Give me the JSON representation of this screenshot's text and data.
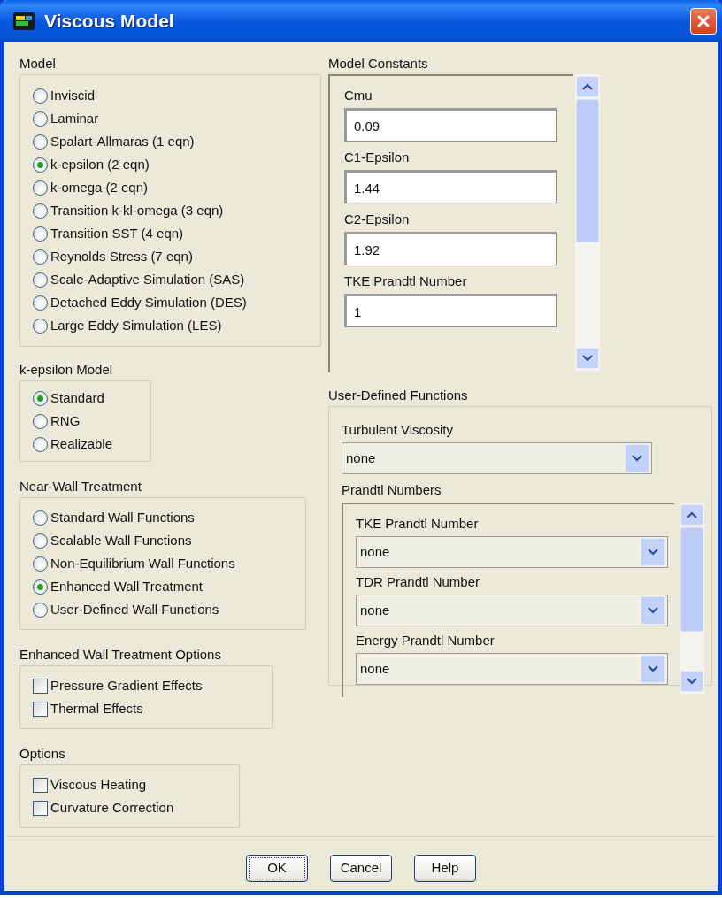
{
  "window": {
    "title": "Viscous Model"
  },
  "model": {
    "label": "Model",
    "options": [
      {
        "label": "Inviscid",
        "selected": false
      },
      {
        "label": "Laminar",
        "selected": false
      },
      {
        "label": "Spalart-Allmaras (1 eqn)",
        "selected": false
      },
      {
        "label": "k-epsilon (2 eqn)",
        "selected": true
      },
      {
        "label": "k-omega (2 eqn)",
        "selected": false
      },
      {
        "label": "Transition k-kl-omega (3 eqn)",
        "selected": false
      },
      {
        "label": "Transition SST (4 eqn)",
        "selected": false
      },
      {
        "label": "Reynolds Stress (7 eqn)",
        "selected": false
      },
      {
        "label": "Scale-Adaptive Simulation (SAS)",
        "selected": false
      },
      {
        "label": "Detached Eddy Simulation (DES)",
        "selected": false
      },
      {
        "label": "Large Eddy Simulation (LES)",
        "selected": false
      }
    ]
  },
  "k_epsilon_model": {
    "label": "k-epsilon Model",
    "options": [
      {
        "label": "Standard",
        "selected": true
      },
      {
        "label": "RNG",
        "selected": false
      },
      {
        "label": "Realizable",
        "selected": false
      }
    ]
  },
  "near_wall_treatment": {
    "label": "Near-Wall Treatment",
    "options": [
      {
        "label": "Standard Wall Functions",
        "selected": false
      },
      {
        "label": "Scalable Wall Functions",
        "selected": false
      },
      {
        "label": "Non-Equilibrium Wall Functions",
        "selected": false
      },
      {
        "label": "Enhanced Wall Treatment",
        "selected": true
      },
      {
        "label": "User-Defined Wall Functions",
        "selected": false
      }
    ]
  },
  "enhanced_wall_treatment_options": {
    "label": "Enhanced Wall Treatment Options",
    "options": [
      {
        "label": "Pressure Gradient Effects",
        "checked": false
      },
      {
        "label": "Thermal Effects",
        "checked": false
      }
    ]
  },
  "options": {
    "label": "Options",
    "options": [
      {
        "label": "Viscous Heating",
        "checked": false
      },
      {
        "label": "Curvature Correction",
        "checked": false
      }
    ]
  },
  "model_constants": {
    "label": "Model Constants",
    "fields": [
      {
        "label": "Cmu",
        "value": "0.09"
      },
      {
        "label": "C1-Epsilon",
        "value": "1.44"
      },
      {
        "label": "C2-Epsilon",
        "value": "1.92"
      },
      {
        "label": "TKE Prandtl Number",
        "value": "1"
      }
    ]
  },
  "user_defined_functions": {
    "label": "User-Defined Functions",
    "turbulent_viscosity": {
      "label": "Turbulent Viscosity",
      "value": "none"
    },
    "prandtl_numbers": {
      "label": "Prandtl Numbers",
      "fields": [
        {
          "label": "TKE Prandtl Number",
          "value": "none"
        },
        {
          "label": "TDR Prandtl Number",
          "value": "none"
        },
        {
          "label": "Energy Prandtl Number",
          "value": "none"
        }
      ]
    }
  },
  "buttons": [
    {
      "label": "OK",
      "focused": true
    },
    {
      "label": "Cancel",
      "focused": false
    },
    {
      "label": "Help",
      "focused": false
    }
  ]
}
